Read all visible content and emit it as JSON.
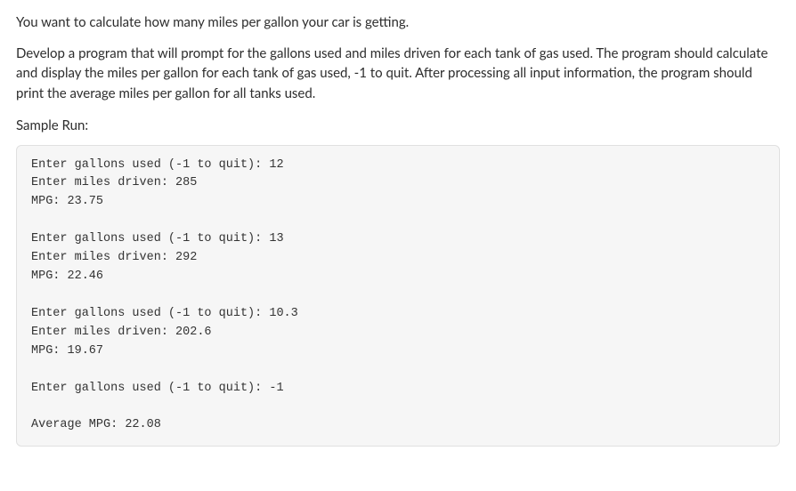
{
  "intro": {
    "p1": "You want to calculate how many miles per gallon your car is getting.",
    "p2": "Develop a program that will prompt for the gallons used and miles driven for each tank of gas used. The program should calculate and display the miles per gallon for each tank of gas used, -1 to quit. After processing all input information, the program should print the average miles per gallon for all tanks used."
  },
  "sample_label": "Sample Run:",
  "sample_output": "Enter gallons used (-1 to quit): 12\nEnter miles driven: 285\nMPG: 23.75\n\nEnter gallons used (-1 to quit): 13\nEnter miles driven: 292\nMPG: 22.46\n\nEnter gallons used (-1 to quit): 10.3\nEnter miles driven: 202.6\nMPG: 19.67\n\nEnter gallons used (-1 to quit): -1\n\nAverage MPG: 22.08"
}
